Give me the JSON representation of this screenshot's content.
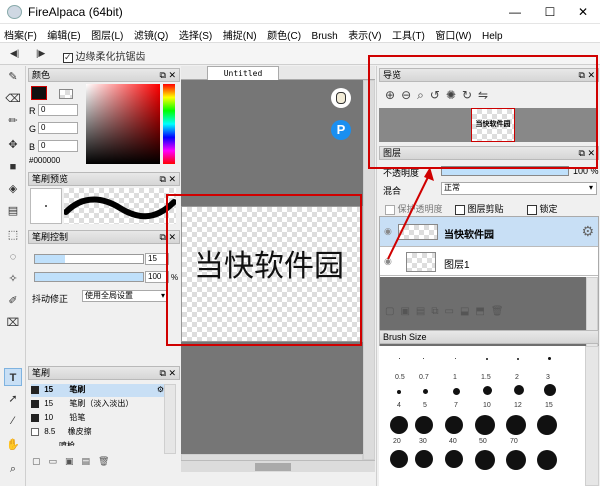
{
  "window": {
    "title": "FireAlpaca (64bit)",
    "minimize": "—",
    "maximize": "☐",
    "close": "✕"
  },
  "menu": [
    "档案(F)",
    "编辑(E)",
    "图层(L)",
    "滤镜(Q)",
    "选择(S)",
    "捕捉(N)",
    "颜色(C)",
    "Brush",
    "表示(V)",
    "工具(T)",
    "窗口(W)",
    "Help"
  ],
  "toolbar": {
    "prev": "◀|",
    "next": "|▶",
    "antialias_label": "边缘柔化抗锯齿",
    "antialias_checked": true
  },
  "color_panel": {
    "title": "颜色",
    "r_label": "R",
    "g_label": "G",
    "b_label": "B",
    "r": "0",
    "g": "0",
    "b": "0",
    "hex": "#000000"
  },
  "brush_preview": {
    "title": "笔刷预览"
  },
  "brush_control": {
    "title": "笔刷控制",
    "size": "15",
    "opacity": "100",
    "opacity_unit": "%",
    "stabilizer_label": "抖动修正",
    "stabilizer_value": "使用全局设置"
  },
  "brush_list": {
    "title": "笔刷",
    "items": [
      {
        "size": "15",
        "name": "笔刷",
        "selected": true
      },
      {
        "size": "15",
        "name": "笔刷（淡入淡出）",
        "selected": false
      },
      {
        "size": "10",
        "name": "铅笔",
        "selected": false
      },
      {
        "size": "8.5",
        "name": "橡皮擦",
        "selected": false
      },
      {
        "size": "",
        "name": "喷枪",
        "selected": false
      }
    ]
  },
  "canvas": {
    "tab": "Untitled",
    "text": "当快软件园"
  },
  "navigator": {
    "title": "导览",
    "thumb_text": "当快软件园"
  },
  "layers": {
    "title": "图层",
    "opacity_label": "不透明度",
    "opacity_value": "100 %",
    "blend_label": "混合",
    "blend_value": "正常",
    "protect_alpha": "保护透明度",
    "clipping": "图层剪贴",
    "lock": "锁定",
    "items": [
      {
        "name": "当快软件园",
        "selected": true
      },
      {
        "name": "图层1",
        "selected": false
      }
    ]
  },
  "brush_size": {
    "title": "Brush Size",
    "labels": [
      "0.5",
      "0.7",
      "1",
      "1.5",
      "2",
      "3",
      "4",
      "5",
      "7",
      "10",
      "12",
      "15",
      "20",
      "30",
      "40",
      "50",
      "70"
    ]
  }
}
